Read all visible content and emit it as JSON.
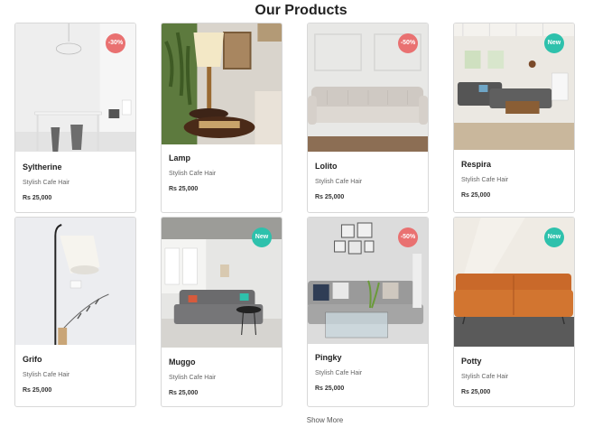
{
  "header": {
    "title": "Our Products"
  },
  "products": [
    {
      "name": "Syltherine",
      "desc": "Stylish Cafe Hair",
      "price": "Rs 25,000",
      "badge": "-30%"
    },
    {
      "name": "Lamp",
      "desc": "Stylish Cafe Hair",
      "price": "Rs 25,000",
      "badge": ""
    },
    {
      "name": "Lolito",
      "desc": "Stylish Cafe Hair",
      "price": "Rs 25,000",
      "badge": "-50%"
    },
    {
      "name": "Respira",
      "desc": "Stylish Cafe Hair",
      "price": "Rs 25,000",
      "badge": "New"
    },
    {
      "name": "Grifo",
      "desc": "Stylish Cafe Hair",
      "price": "Rs 25,000",
      "badge": ""
    },
    {
      "name": "Muggo",
      "desc": "Stylish Cafe Hair",
      "price": "Rs 25,000",
      "badge": "New"
    },
    {
      "name": "Pingky",
      "desc": "Stylish Cafe Hair",
      "price": "Rs 25,000",
      "badge": "-50%"
    },
    {
      "name": "Potty",
      "desc": "Stylish Cafe Hair",
      "price": "Rs 25,000",
      "badge": "New"
    }
  ],
  "footer": {
    "show_more_label": "Show More"
  },
  "colors": {
    "sale_badge": "#e97171",
    "new_badge": "#2ec1ac"
  }
}
